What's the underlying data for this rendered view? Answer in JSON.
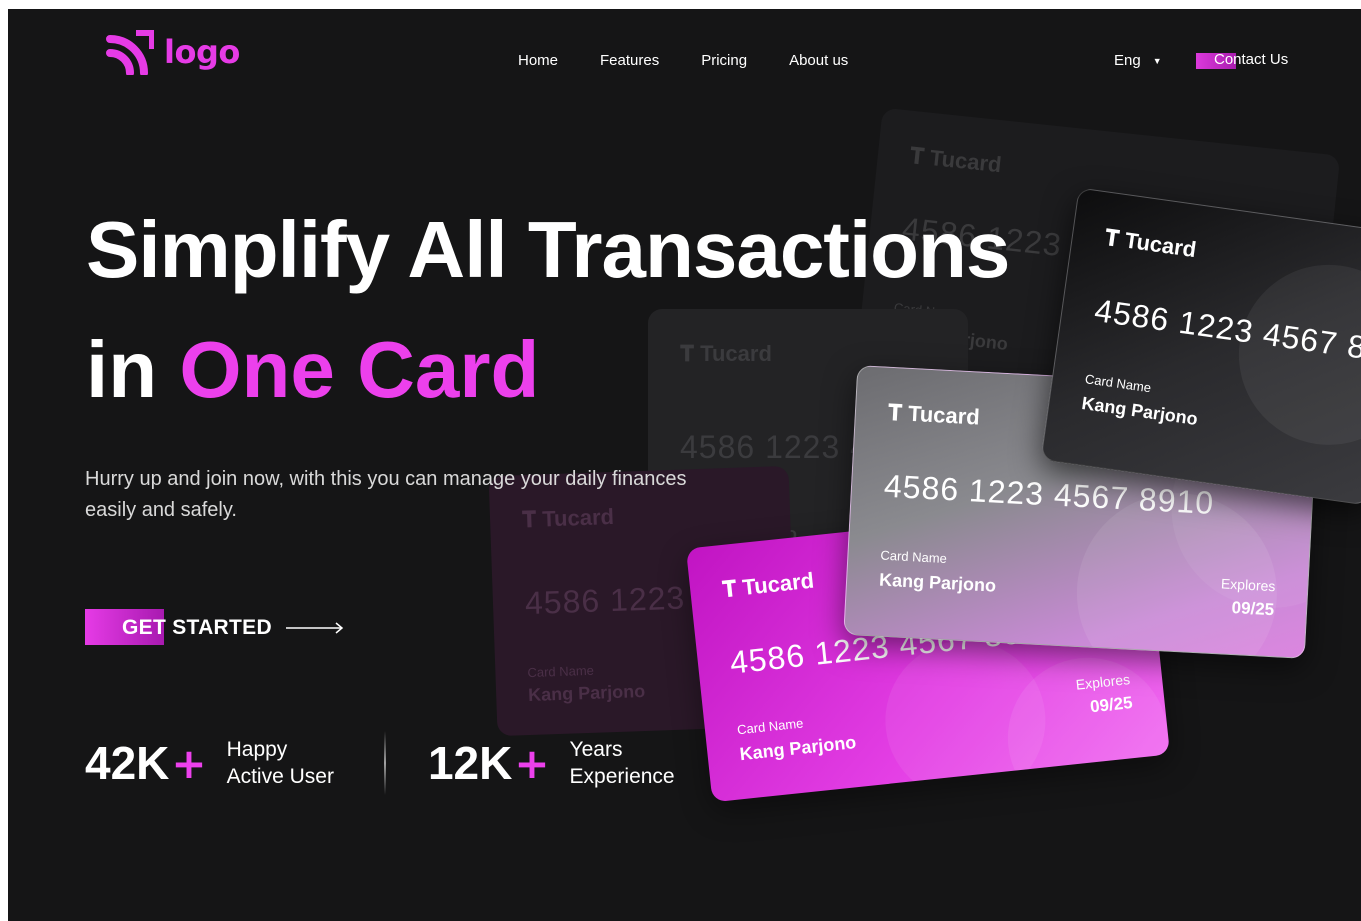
{
  "brand": {
    "name": "logo",
    "color": "#e63be6"
  },
  "nav": {
    "items": [
      "Home",
      "Features",
      "Pricing",
      "About us"
    ]
  },
  "lang": {
    "current": "Eng"
  },
  "contact": {
    "label": "Contact Us"
  },
  "hero": {
    "title_line1": "Simplify All Transactions",
    "title_line2_prefix": "in ",
    "title_line2_accent": "One Card",
    "subtitle": "Hurry up and join now, with this you can manage your daily finances easily and safely.",
    "cta_label": "GET STARTED"
  },
  "stats": [
    {
      "value": "42K",
      "suffix": "+",
      "label_line1": "Happy",
      "label_line2": "Active User"
    },
    {
      "value": "12K",
      "suffix": "+",
      "label_line1": "Years",
      "label_line2": "Experience"
    }
  ],
  "cards": {
    "brand": "Tucard",
    "number": "4586 1223 4567 8910",
    "name_label": "Card Name",
    "holder": "Kang Parjono",
    "expiry_label": "Explores",
    "expiry": "09/25"
  },
  "colors": {
    "accent": "#ec40ec",
    "background": "#151516"
  }
}
